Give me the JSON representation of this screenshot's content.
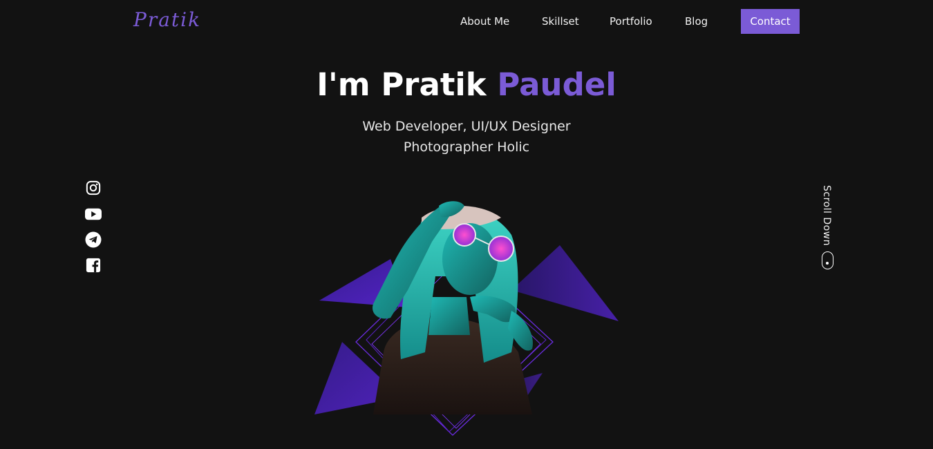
{
  "brand": {
    "logo_text": "Pratik"
  },
  "nav": {
    "items": [
      {
        "label": "About Me"
      },
      {
        "label": "Skillset"
      },
      {
        "label": "Portfolio"
      },
      {
        "label": "Blog"
      }
    ],
    "contact_label": "Contact"
  },
  "hero": {
    "title_main": "I'm Pratik ",
    "title_accent": "Paudel",
    "subtitle_line1": "Web Developer, UI/UX Designer",
    "subtitle_line2": "Photographer Holic"
  },
  "social": {
    "icons": [
      "instagram-icon",
      "youtube-icon",
      "telegram-icon",
      "facebook-icon"
    ]
  },
  "scroll": {
    "label": "Scroll Down"
  },
  "colors": {
    "background": "#121212",
    "accent": "#7b5bd6",
    "text": "#ffffff"
  }
}
